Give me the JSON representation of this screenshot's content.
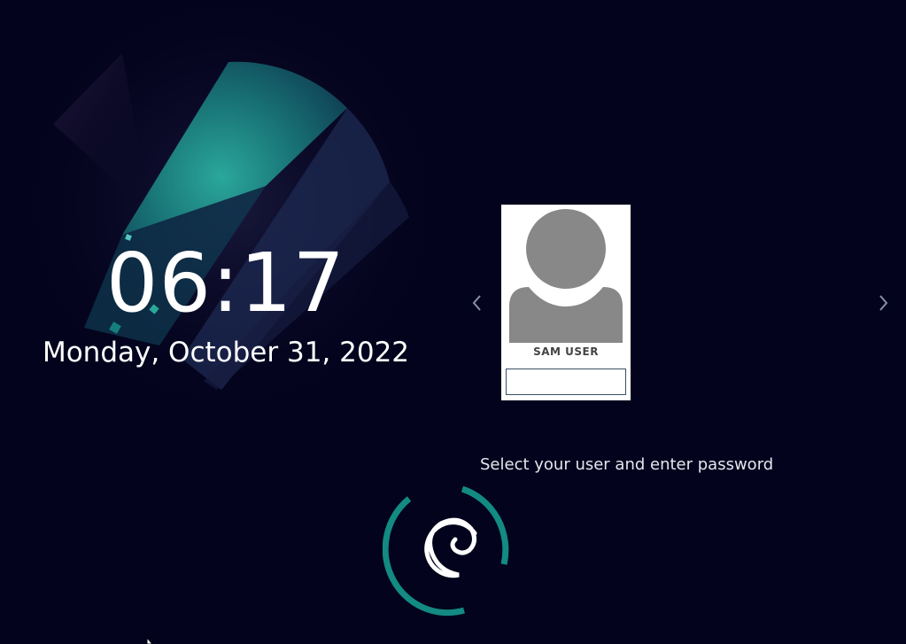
{
  "clock": {
    "time": "06:17",
    "date": "Monday, October 31, 2022"
  },
  "users": {
    "selected_index": 0,
    "items": [
      {
        "name": "SAM USER",
        "avatar_icon": "default-user-silhouette-icon"
      }
    ]
  },
  "login": {
    "password_value": "",
    "hint": "Select your user and enter password"
  },
  "icons": {
    "prev": "chevron-left-icon",
    "next": "chevron-right-icon",
    "logo": "debian-swirl-logo-icon",
    "cursor": "mouse-pointer-icon"
  },
  "colors": {
    "background": "#03031d",
    "accent": "#138a82",
    "card": "#ffffff",
    "avatar": "#888888",
    "arrow": "#8a8fa8"
  }
}
